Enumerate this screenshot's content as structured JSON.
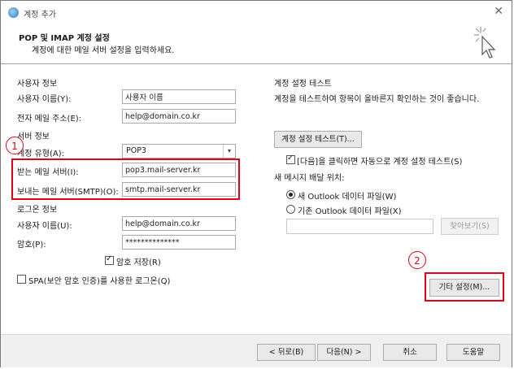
{
  "window": {
    "title": "계정 추가",
    "close_glyph": "✕"
  },
  "header": {
    "title": "POP 및 IMAP 계정 설정",
    "subtitle": "계정에 대한 메일 서버 설정을 입력하세요."
  },
  "user_info": {
    "section": "사용자 정보",
    "name_label": "사용자 이름(Y):",
    "name_value": "사용자 이름",
    "email_label": "전자 메일 주소(E):",
    "email_value": "help@domain.co.kr"
  },
  "server_info": {
    "section": "서버 정보",
    "type_label": "계정 유형(A):",
    "type_value": "POP3",
    "incoming_label": "받는 메일 서버(I):",
    "incoming_value": "pop3.mail-server.kr",
    "outgoing_label": "보내는 메일 서버(SMTP)(O):",
    "outgoing_value": "smtp.mail-server.kr"
  },
  "login_info": {
    "section": "로그온 정보",
    "user_label": "사용자 이름(U):",
    "user_value": "help@domain.co.kr",
    "password_label": "암호(P):",
    "password_value": "**************",
    "remember_label": "암호 저장(R)",
    "remember_checked": true,
    "spa_label": "SPA(보안 암호 인증)를 사용한 로그온(Q)",
    "spa_checked": false
  },
  "test": {
    "section": "계정 설정 테스트",
    "description": "계정을 테스트하여 항목이 올바른지 확인하는 것이 좋습니다.",
    "test_button": "계정 설정 테스트(T)...",
    "auto_test_label": "[다음]을 클릭하면 자동으로 계정 설정 테스트(S)",
    "auto_test_checked": true
  },
  "delivery": {
    "section": "새 메시지 배달 위치:",
    "option_new": "새 Outlook 데이터 파일(W)",
    "option_existing": "기존 Outlook 데이터 파일(X)",
    "selected": "new",
    "path_value": "",
    "browse_button": "찾아보기(S)"
  },
  "more_settings_button": "기타 설정(M)...",
  "annotations": {
    "marker_1": "1",
    "marker_2": "2",
    "color": "#e3001b"
  },
  "footer": {
    "back": "< 뒤로(B)",
    "next": "다음(N) >",
    "cancel": "취소",
    "help": "도움말"
  }
}
